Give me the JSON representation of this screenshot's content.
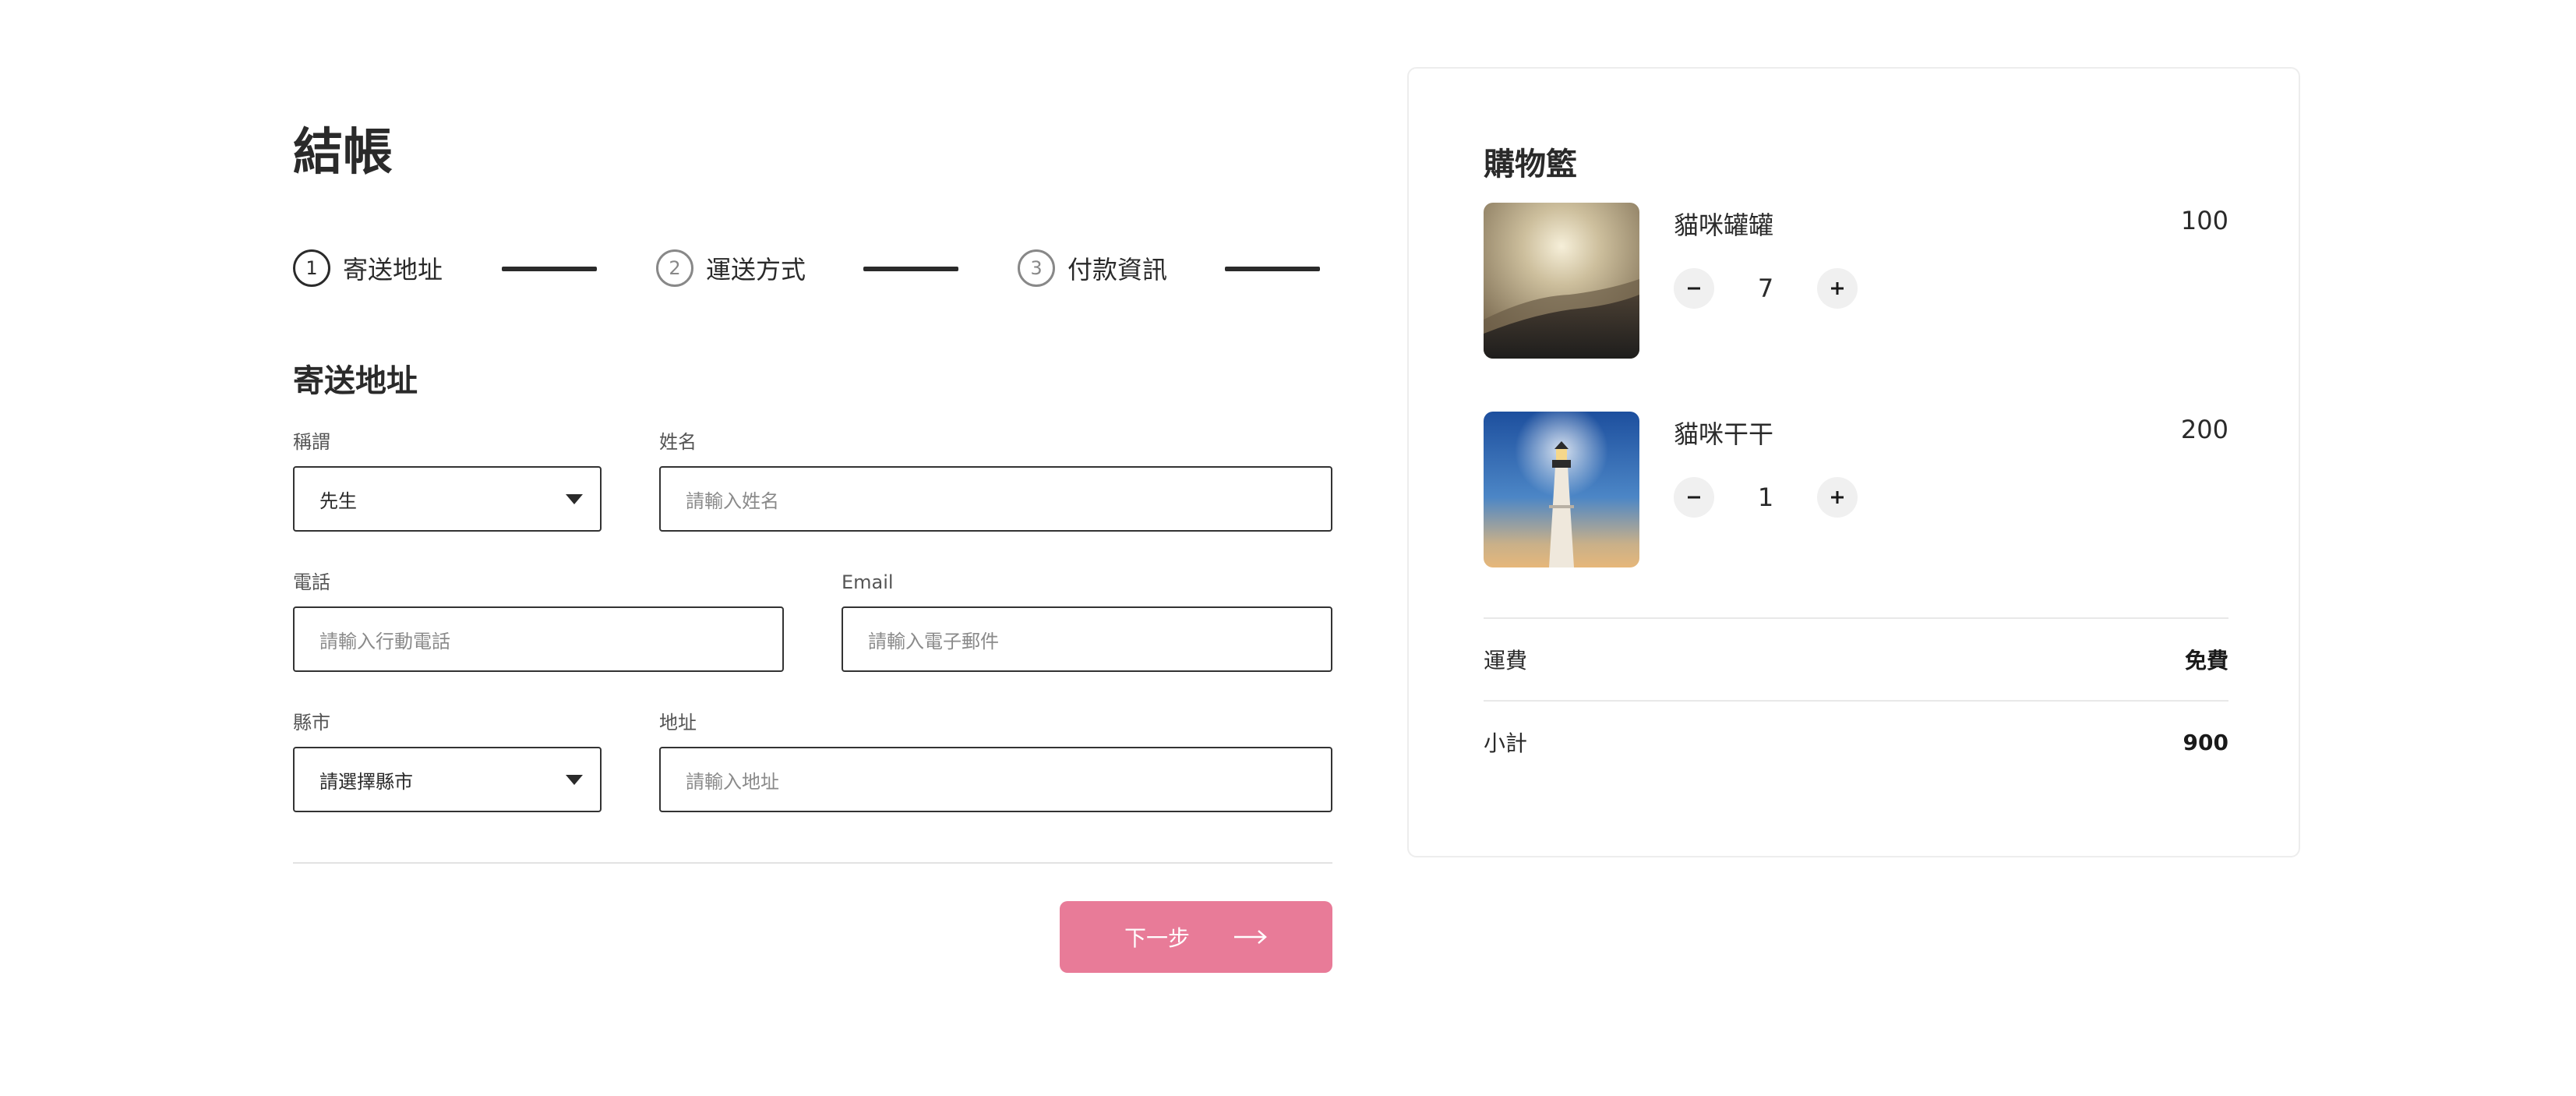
{
  "checkout": {
    "title": "結帳",
    "steps": [
      {
        "num": "1",
        "label": "寄送地址",
        "active": true
      },
      {
        "num": "2",
        "label": "運送方式",
        "active": false
      },
      {
        "num": "3",
        "label": "付款資訊",
        "active": false
      }
    ],
    "section_title": "寄送地址",
    "fields": {
      "salutation": {
        "label": "稱謂",
        "value": "先生"
      },
      "name": {
        "label": "姓名",
        "placeholder": "請輸入姓名"
      },
      "phone": {
        "label": "電話",
        "placeholder": "請輸入行動電話"
      },
      "email": {
        "label": "Email",
        "placeholder": "請輸入電子郵件"
      },
      "city": {
        "label": "縣市",
        "value": "請選擇縣市"
      },
      "address": {
        "label": "地址",
        "placeholder": "請輸入地址"
      }
    },
    "next_button": "下一步"
  },
  "cart": {
    "title": "購物籃",
    "items": [
      {
        "name": "貓咪罐罐",
        "price": "100",
        "qty": "7",
        "image": "misty-mountain-sunrise"
      },
      {
        "name": "貓咪干干",
        "price": "200",
        "qty": "1",
        "image": "lighthouse-at-dusk"
      }
    ],
    "shipping": {
      "label": "運費",
      "value": "免費"
    },
    "subtotal": {
      "label": "小計",
      "value": "900"
    }
  },
  "colors": {
    "accent": "#e87b98",
    "text": "#2a2a2a",
    "border": "#333333"
  },
  "icons": [
    "caret-down-icon",
    "arrow-right-icon",
    "minus-icon",
    "plus-icon"
  ]
}
